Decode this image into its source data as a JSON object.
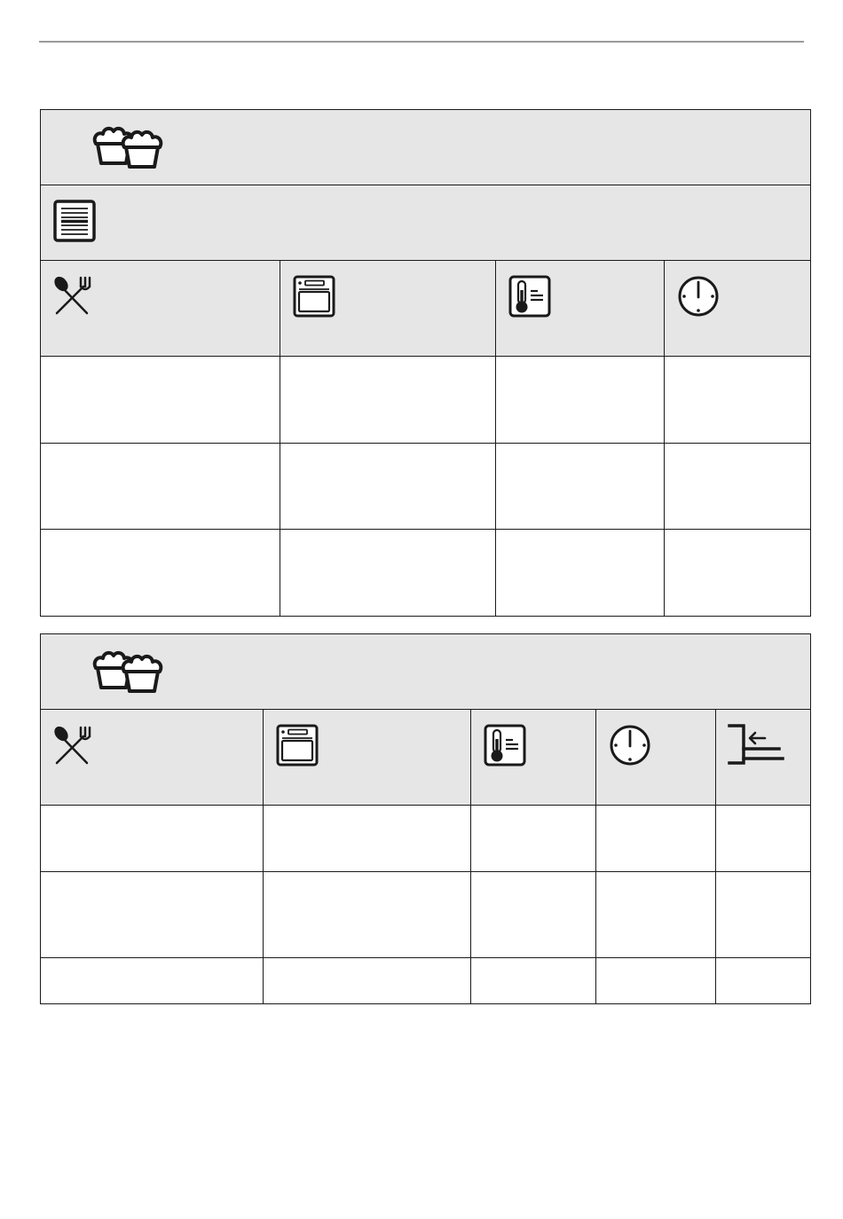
{
  "page": {
    "colors": {
      "header_fill": "#e6e6e6",
      "border": "#1a1a1a",
      "icon": "#1a1a1a",
      "rule": "#9a9a9a"
    }
  },
  "table1": {
    "header_icon": "cupcakes-icon",
    "subheader_icon": "tray-lines-icon",
    "column_icons": [
      "spoon-fork-icon",
      "oven-icon",
      "thermometer-icon",
      "clock-icon"
    ],
    "rows": [
      [
        "",
        "",
        "",
        ""
      ],
      [
        "",
        "",
        "",
        ""
      ],
      [
        "",
        "",
        "",
        ""
      ]
    ]
  },
  "table2": {
    "header_icon": "cupcakes-icon",
    "column_icons": [
      "spoon-fork-icon",
      "oven-icon",
      "thermometer-icon",
      "clock-icon",
      "shelf-level-icon"
    ],
    "rows": [
      [
        "",
        "",
        "",
        "",
        ""
      ],
      [
        "",
        "",
        "",
        "",
        ""
      ],
      [
        "",
        "",
        "",
        "",
        ""
      ]
    ]
  }
}
